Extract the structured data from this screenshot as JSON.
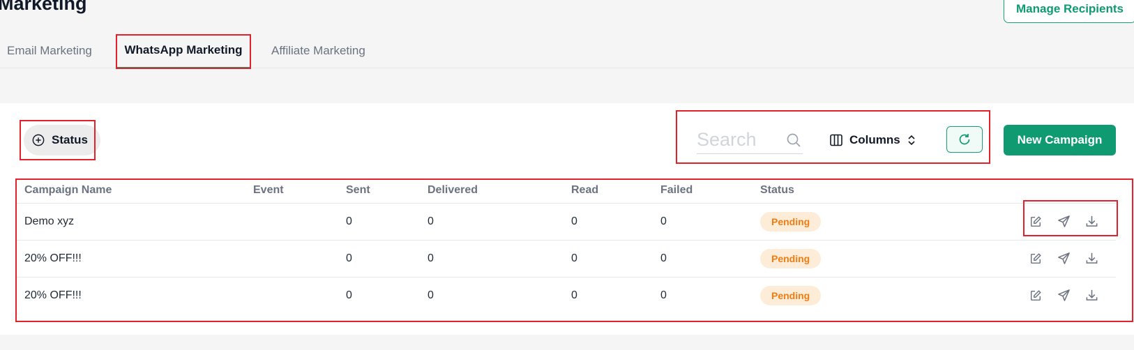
{
  "header": {
    "title": "Marketing",
    "manage_recipients_label": "Manage Recipients"
  },
  "tabs": [
    {
      "label": "Email Marketing",
      "active": false
    },
    {
      "label": "WhatsApp Marketing",
      "active": true
    },
    {
      "label": "Affiliate Marketing",
      "active": false
    }
  ],
  "toolbar": {
    "status_filter_label": "Status",
    "search_placeholder": "Search",
    "columns_label": "Columns",
    "new_campaign_label": "New Campaign"
  },
  "table": {
    "columns": [
      "Campaign Name",
      "Event",
      "Sent",
      "Delivered",
      "Read",
      "Failed",
      "Status"
    ],
    "rows": [
      {
        "name": "Demo xyz",
        "event": "",
        "sent": "0",
        "delivered": "0",
        "read": "0",
        "failed": "0",
        "status": "Pending"
      },
      {
        "name": "20% OFF!!!",
        "event": "",
        "sent": "0",
        "delivered": "0",
        "read": "0",
        "failed": "0",
        "status": "Pending"
      },
      {
        "name": "20% OFF!!!",
        "event": "",
        "sent": "0",
        "delivered": "0",
        "read": "0",
        "failed": "0",
        "status": "Pending"
      }
    ]
  },
  "icons": [
    "plus-circle-icon",
    "search-icon",
    "columns-icon",
    "chevron-up-down-icon",
    "refresh-icon",
    "edit-icon",
    "send-icon",
    "download-icon"
  ],
  "colors": {
    "accent": "#0f9a72",
    "pending_text": "#f07c12",
    "pending_bg": "#fdedd8",
    "highlight": "#e3212b"
  }
}
